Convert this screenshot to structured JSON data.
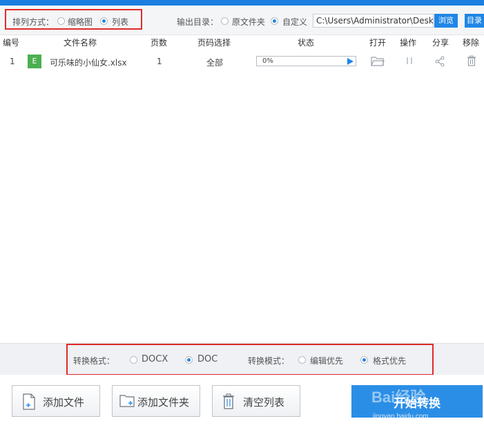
{
  "toolbar": {
    "sort_label": "排列方式：",
    "sort_options": [
      {
        "label": "缩略图",
        "selected": false
      },
      {
        "label": "列表",
        "selected": true
      }
    ],
    "output_label": "输出目录：",
    "output_options": [
      {
        "label": "原文件夹",
        "selected": false
      },
      {
        "label": "自定义",
        "selected": true
      }
    ],
    "output_path": "C:\\Users\\Administrator\\Deskto",
    "browse_label": "浏览",
    "dir_label": "目录"
  },
  "table": {
    "columns": [
      "编号",
      "文件名称",
      "页数",
      "页码选择",
      "状态",
      "打开",
      "操作",
      "分享",
      "移除"
    ],
    "rows": [
      {
        "index": "1",
        "file_type_badge": "E",
        "name": "可乐味的小仙女.xlsx",
        "pages": "1",
        "page_range": "全部",
        "progress_text": "0%",
        "progress": 0
      }
    ]
  },
  "conversion": {
    "format_label": "转换格式：",
    "format_options": [
      {
        "label": "DOCX",
        "selected": false
      },
      {
        "label": "DOC",
        "selected": true
      }
    ],
    "mode_label": "转换模式：",
    "mode_options": [
      {
        "label": "编辑优先",
        "selected": false
      },
      {
        "label": "格式优先",
        "selected": true
      }
    ]
  },
  "actions": {
    "add_file": "添加文件",
    "add_folder": "添加文件夹",
    "clear_list": "清空列表",
    "start": "开始转换"
  },
  "watermark": {
    "logo": "Bai经验",
    "url": "jingyan.baidu.com"
  },
  "colors": {
    "accent": "#1f86e6",
    "highlight_box": "#e02a2a",
    "excel_badge": "#4caf50"
  }
}
